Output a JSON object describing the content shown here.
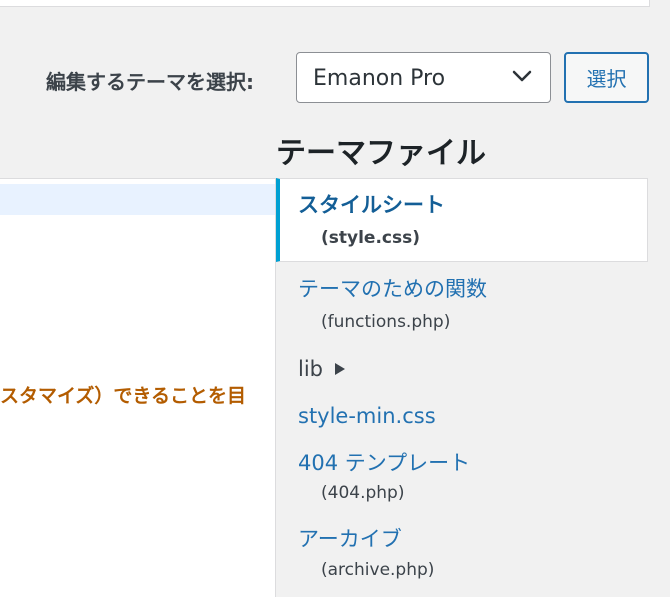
{
  "theme_select": {
    "label": "編集するテーマを選択:",
    "selected": "Emanon Pro",
    "button_label": "選択"
  },
  "editor": {
    "visible_code": "スタマイズ）できることを目"
  },
  "file_panel": {
    "title": "テーマファイル",
    "active_file": {
      "name": "スタイルシート",
      "path": "(style.css)"
    },
    "files": [
      {
        "name": "テーマのための関数",
        "path": "(functions.php)"
      },
      {
        "folder": "lib"
      },
      {
        "name": "style-min.css"
      },
      {
        "name": "404 テンプレート",
        "path": "(404.php)"
      },
      {
        "name": "アーカイブ",
        "path": "(archive.php)"
      }
    ]
  },
  "icons": {
    "select_arrow": "chevron-down-icon",
    "folder_arrow": "caret-right-icon"
  },
  "colors": {
    "link": "#2271b1",
    "active_border": "#00a0d2",
    "code_string": "#b35c00",
    "background": "#f1f1f1"
  }
}
